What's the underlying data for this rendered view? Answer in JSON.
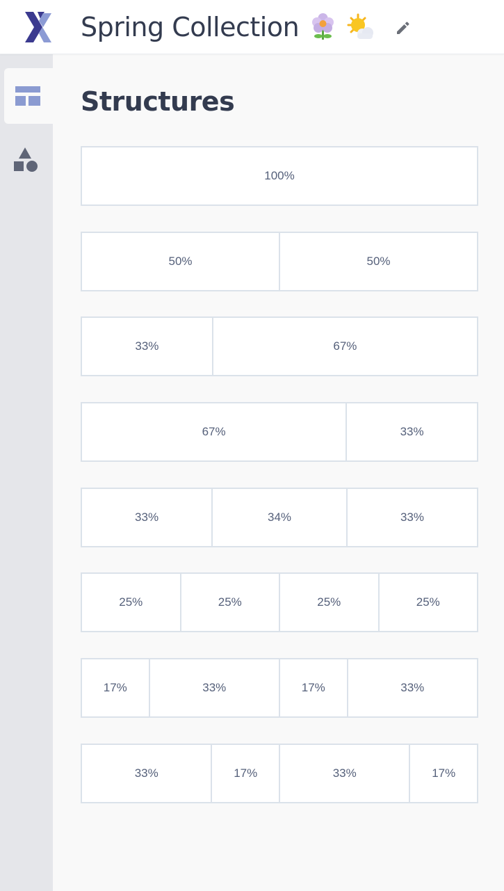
{
  "header": {
    "title": "Spring Collection",
    "logo_icon": "x-logo-icon",
    "emojis": [
      "flower-emoji",
      "sun-behind-cloud-emoji"
    ],
    "edit_icon": "pencil-icon"
  },
  "sidebar": {
    "items": [
      {
        "icon": "layout-structures-icon",
        "active": true
      },
      {
        "icon": "shapes-content-icon",
        "active": false
      }
    ]
  },
  "main": {
    "section_title": "Structures",
    "structures": [
      {
        "columns": [
          "100%"
        ]
      },
      {
        "columns": [
          "50%",
          "50%"
        ]
      },
      {
        "columns": [
          "33%",
          "67%"
        ]
      },
      {
        "columns": [
          "67%",
          "33%"
        ]
      },
      {
        "columns": [
          "33%",
          "34%",
          "33%"
        ]
      },
      {
        "columns": [
          "25%",
          "25%",
          "25%",
          "25%"
        ]
      },
      {
        "columns": [
          "17%",
          "33%",
          "17%",
          "33%"
        ]
      },
      {
        "columns": [
          "33%",
          "17%",
          "33%",
          "17%"
        ]
      }
    ]
  },
  "colors": {
    "logo_dark": "#3b3a8f",
    "logo_light": "#8c9bd4",
    "sidebar_active_icon": "#8b9bd1",
    "sidebar_icon": "#5f6577",
    "border": "#dbe2ea",
    "text": "#333b4f"
  }
}
